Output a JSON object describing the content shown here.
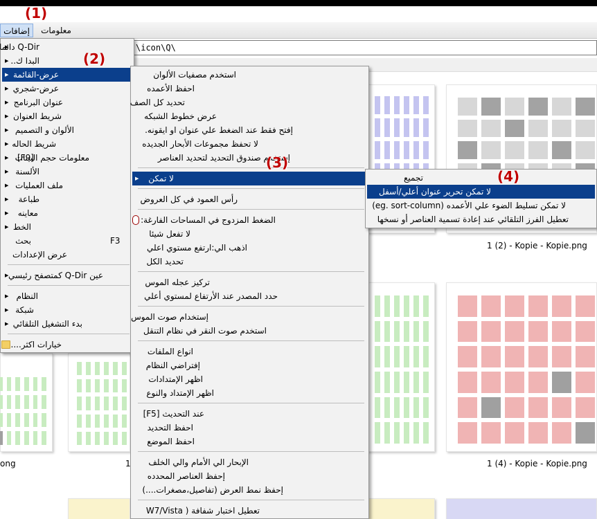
{
  "annotations": [
    "(1)",
    "(2)",
    "(3)",
    "(4)"
  ],
  "menubar": {
    "extras": "إضافات",
    "info": "معلومات"
  },
  "address": "\\icon\\Q\\",
  "files": [
    {
      "name": "1 (2) - Kopie - Kopie.png"
    },
    {
      "name": "1 (4) - Kopie - Kopie.png"
    },
    {
      "name": "ong"
    },
    {
      "name": "1"
    }
  ],
  "menu1": {
    "items": [
      {
        "label": "Q-Dir دائما...",
        "sub": true
      },
      {
        "label": "البدا ك..",
        "sub": true
      },
      {
        "label": "عرض-القائمة",
        "sub": true
      },
      {
        "label": "عرض-شجري",
        "sub": true
      },
      {
        "label": "عنوان البرنامج",
        "sub": true
      },
      {
        "label": "شريط العنوان",
        "sub": true
      },
      {
        "label": "الألوان و التصميم",
        "sub": true
      },
      {
        "label": "شريط الحاله",
        "sub": true
      },
      {
        "label": "معلومات حجم البينات",
        "shortcut": "[F9]",
        "sub": true
      },
      {
        "label": "الألسنة",
        "sub": true
      },
      {
        "label": "ملف العمليات",
        "sub": true
      },
      {
        "label": "طباعة",
        "sub": true
      },
      {
        "label": "معاينه",
        "sub": true
      },
      {
        "label": "الخط",
        "sub": true
      },
      {
        "label": "بحث",
        "shortcut": "F3",
        "sub": true
      },
      {
        "label": "عرض الإعدادات"
      },
      {
        "label": "عين Q-Dir كمتصفح رئيسي",
        "sub": true
      },
      {
        "label": "النظام",
        "sub": true
      },
      {
        "label": "شبكة",
        "sub": true
      },
      {
        "label": "بدء التشغيل التلقائي",
        "sub": true
      },
      {
        "label": "خيارات اكثر...."
      }
    ]
  },
  "menu2": {
    "items": [
      {
        "label": "استخدم مصفيات الألوان"
      },
      {
        "label": "احفظ الأعمده"
      },
      {
        "label": "تحديد كل الصف"
      },
      {
        "label": "عرض خطوط الشبكه"
      },
      {
        "label": "إفتح فقط عند الضغط علي عنوان او ايقونه."
      },
      {
        "label": "لا تحفظ مجموعات الأبحار الجديده"
      },
      {
        "label": "إستخدم صندوق التحديد لتحديد العناصر"
      },
      {
        "label": "لا تمكن",
        "sub": true
      },
      {
        "label": "رأس العمود في كل العروض"
      },
      {
        "label": "الضغط المزدوج في المساحات الفارغة:"
      },
      {
        "label": "لا تفعل شيئا"
      },
      {
        "label": "اذهب الي:ارتفع مستوي اعلي"
      },
      {
        "label": "تحديد الكل"
      },
      {
        "label": "تركيز عجله الموس"
      },
      {
        "label": "حدد المصدر عند الأرتفاع لمستوي أعلي"
      },
      {
        "label": "إستخدام صوت الموس"
      },
      {
        "label": "استخدم صوت النقر في نظام التنقل"
      },
      {
        "label": "انواع الملفات"
      },
      {
        "label": "إفتراضي النظام"
      },
      {
        "label": "اظهر الإمتدادات"
      },
      {
        "label": "اظهر الإمتداد والنوع"
      },
      {
        "label": "عند التحديث [F5]"
      },
      {
        "label": "احفظ التحديد"
      },
      {
        "label": "احفظ الموضع"
      },
      {
        "label": "الإبحار الي الأمام والي الخلف"
      },
      {
        "label": "إحفظ العناصر المحدده"
      },
      {
        "label": "إحفظ نمط العرض (تفاصيل،مصغرات....)"
      },
      {
        "label": "تعطيل اختبار شفافة ( W7/Vista"
      }
    ]
  },
  "menu3": {
    "items": [
      {
        "label": "تجميع"
      },
      {
        "label": "لا تمكن تحرير عنوان أعلي/أسفل"
      },
      {
        "label": "لا تمكن تسليط الضوء علي الأعمده (eg. sort-column)"
      },
      {
        "label": "تعطيل الفرز التلقائي عند إعادة تسمية العناصر أو نسخها"
      }
    ]
  }
}
